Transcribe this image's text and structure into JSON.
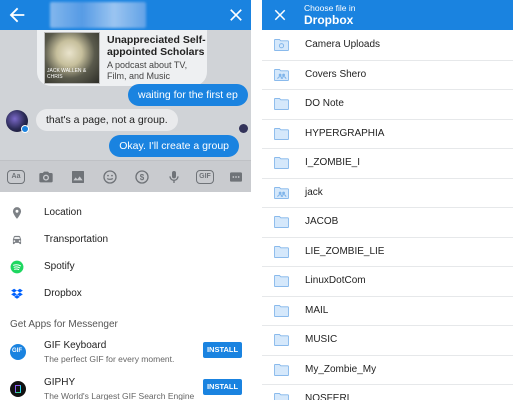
{
  "left": {
    "link_card": {
      "thumb_text": "JACK WALLEN & CHRIS",
      "title": "Unappreciated Self-appointed Scholars",
      "description": "A podcast about TV, Film, and Music"
    },
    "messages": {
      "out1": "waiting for the first ep",
      "in1": "that's a page, not a group.",
      "out2": "Okay. I'll create a group"
    },
    "toolbar": {
      "aa": "Aa",
      "gif": "GIF"
    },
    "menu_items": [
      {
        "label": "Location"
      },
      {
        "label": "Transportation"
      },
      {
        "label": "Spotify"
      },
      {
        "label": "Dropbox"
      }
    ],
    "apps_section": "Get Apps for Messenger",
    "apps": [
      {
        "name": "GIF Keyboard",
        "desc": "The perfect GIF for every moment.",
        "button": "INSTALL",
        "icon_text": "GIF"
      },
      {
        "name": "GIPHY",
        "desc": "The World's Largest GIF Search Engine",
        "button": "INSTALL"
      }
    ],
    "colors": {
      "accent": "#1a83e0",
      "spotify": "#1ed760",
      "dropbox": "#0061fe"
    }
  },
  "right": {
    "header_sub": "Choose file in",
    "header_title": "Dropbox",
    "folders": [
      {
        "name": "Camera Uploads",
        "icon": "camera-folder-icon"
      },
      {
        "name": "Covers Shero",
        "icon": "shared-folder-icon"
      },
      {
        "name": "DO Note",
        "icon": "folder-icon"
      },
      {
        "name": "HYPERGRAPHIA",
        "icon": "folder-icon"
      },
      {
        "name": "I_ZOMBIE_I",
        "icon": "folder-icon"
      },
      {
        "name": "jack",
        "icon": "shared-folder-icon"
      },
      {
        "name": "JACOB",
        "icon": "folder-icon"
      },
      {
        "name": "LIE_ZOMBIE_LIE",
        "icon": "folder-icon"
      },
      {
        "name": "LinuxDotCom",
        "icon": "folder-icon"
      },
      {
        "name": "MAIL",
        "icon": "folder-icon"
      },
      {
        "name": "MUSIC",
        "icon": "folder-icon"
      },
      {
        "name": "My_Zombie_My",
        "icon": "folder-icon"
      },
      {
        "name": "NOSFERI",
        "icon": "folder-icon"
      }
    ]
  }
}
